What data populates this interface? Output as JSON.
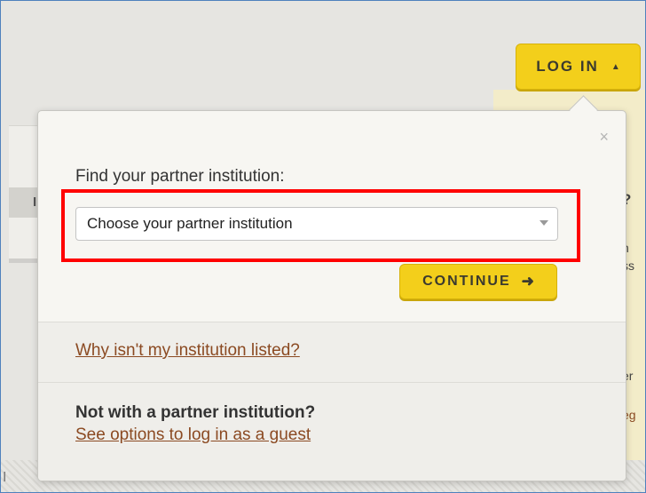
{
  "header": {
    "login_label": "LOG IN",
    "login_caret": "▲"
  },
  "background": {
    "right_text_1": "?",
    "right_text_2": "n",
    "right_text_3": "ss",
    "right_text_4": "er",
    "right_text_5": "eg",
    "left_tab_letter": "I",
    "bottom_letter": "I"
  },
  "popup": {
    "close_icon": "×",
    "find_label": "Find your partner institution:",
    "select": {
      "selected_value": "Choose your partner institution"
    },
    "continue_label": "CONTINUE",
    "continue_arrow": "➜",
    "why_link": "Why isn't my institution listed?",
    "guest_heading": "Not with a partner institution?",
    "guest_link": "See options to log in as a guest"
  },
  "colors": {
    "accent_yellow": "#f3cf1b",
    "link_brown": "#8b4a22",
    "highlight_red": "#ff0000",
    "frame_blue": "#4f81bd"
  }
}
